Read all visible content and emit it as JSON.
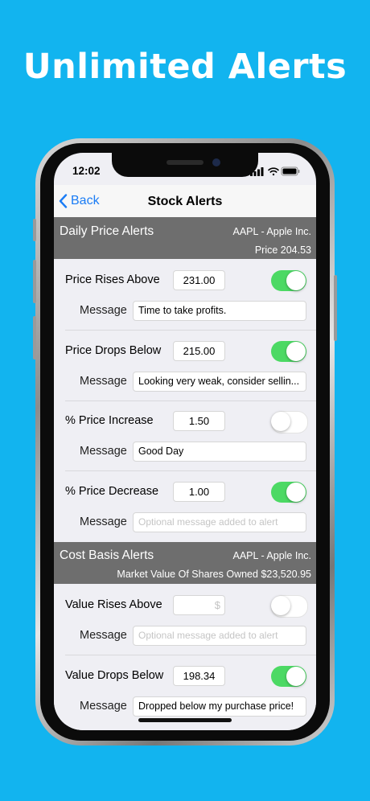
{
  "promo": {
    "headline": "Unlimited Alerts"
  },
  "status_bar": {
    "time": "12:02"
  },
  "nav": {
    "back_label": "Back",
    "title": "Stock Alerts"
  },
  "daily_section": {
    "title": "Daily Price Alerts",
    "symbol": "AAPL - Apple Inc.",
    "price_text": "Price  204.53",
    "alerts": [
      {
        "label": "Price Rises Above",
        "value": "231.00",
        "enabled": true,
        "message_label": "Message",
        "message": "Time to take profits."
      },
      {
        "label": "Price Drops Below",
        "value": "215.00",
        "enabled": true,
        "message_label": "Message",
        "message": "Looking very weak, consider sellin..."
      },
      {
        "label": "% Price Increase",
        "value": "1.50",
        "enabled": false,
        "message_label": "Message",
        "message": "Good Day"
      },
      {
        "label": "% Price Decrease",
        "value": "1.00",
        "enabled": true,
        "message_label": "Message",
        "message_placeholder": "Optional message added to alert"
      }
    ]
  },
  "cost_section": {
    "title": "Cost Basis Alerts",
    "symbol": "AAPL - Apple Inc.",
    "market_value_text": "Market Value Of Shares Owned  $23,520.95",
    "alerts": [
      {
        "label": "Value Rises Above",
        "value_placeholder": "$",
        "enabled": false,
        "message_label": "Message",
        "message_placeholder": "Optional message added to alert"
      },
      {
        "label": "Value Drops Below",
        "value": "198.34",
        "enabled": true,
        "message_label": "Message",
        "message": "Dropped below my purchase price!"
      }
    ]
  },
  "colors": {
    "background": "#12b4ef",
    "toggle_on": "#4cd964",
    "link_blue": "#1a7cf5",
    "section_header": "#6e6e6e"
  },
  "icons": [
    "back-chevron-icon",
    "wifi-icon",
    "battery-icon",
    "signal-icon"
  ]
}
